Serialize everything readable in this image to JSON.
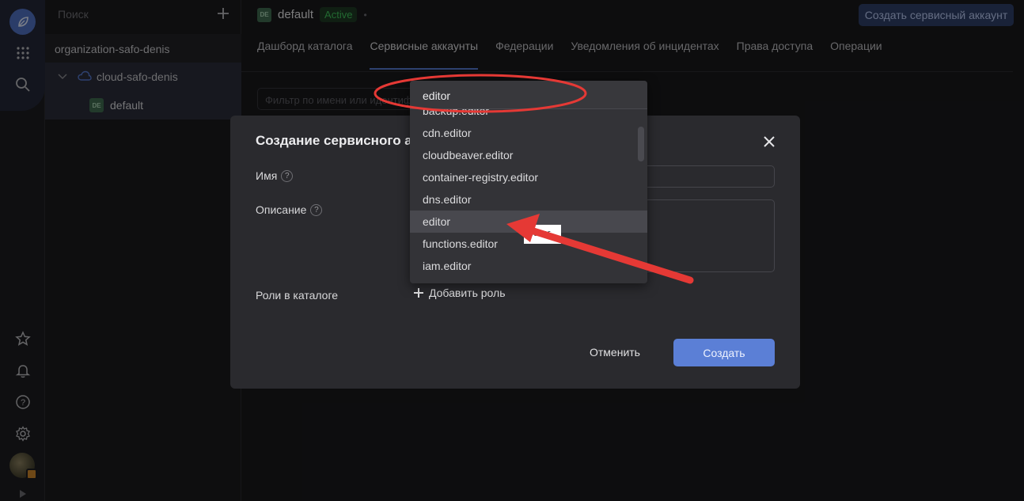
{
  "sidebar_rail": {
    "icons": [
      "leaf-logo-icon",
      "apps-grid-icon",
      "search-icon",
      "star-icon",
      "bell-icon",
      "help-icon",
      "gear-icon",
      "avatar",
      "collapse-arrow-icon"
    ]
  },
  "tree": {
    "search_placeholder": "Поиск",
    "organization": "organization-safo-denis",
    "cloud": "cloud-safo-denis",
    "folder_badge": "DE",
    "folder": "default"
  },
  "header": {
    "folder_badge": "DE",
    "folder_name": "default",
    "status": "Active",
    "create_button": "Создать сервисный аккаунт"
  },
  "tabs": [
    {
      "label": "Дашборд каталога"
    },
    {
      "label": "Сервисные аккаунты"
    },
    {
      "label": "Федерации"
    },
    {
      "label": "Уведомления об инцидентах"
    },
    {
      "label": "Права доступа"
    },
    {
      "label": "Операции"
    }
  ],
  "filter_placeholder": "Фильтр по имени или идентиф",
  "modal": {
    "title": "Создание сервисного ак",
    "name_label": "Имя",
    "description_label": "Описание",
    "roles_label": "Роли в каталоге",
    "add_role": "Добавить роль",
    "cancel": "Отменить",
    "create": "Создать"
  },
  "dropdown": {
    "search_value": "editor",
    "items": [
      {
        "label": "backup.editor"
      },
      {
        "label": "cdn.editor"
      },
      {
        "label": "cloudbeaver.editor"
      },
      {
        "label": "container-registry.editor"
      },
      {
        "label": "dns.editor"
      },
      {
        "label": "editor"
      },
      {
        "label": "functions.editor"
      },
      {
        "label": "iam.editor"
      }
    ],
    "highlighted_index": 5,
    "tooltip": "editor"
  },
  "colors": {
    "accent": "#5b7fd6",
    "annotation": "#e53935",
    "active_status": "#3fbf5a"
  }
}
